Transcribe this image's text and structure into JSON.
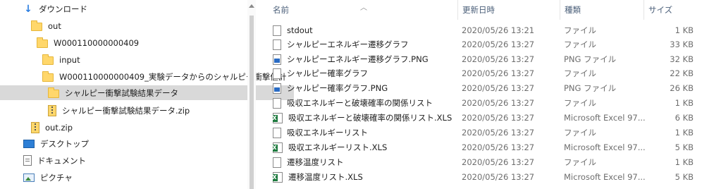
{
  "nav": {
    "items": [
      {
        "label": "ダウンロード",
        "icon": "download-arrow-icon"
      },
      {
        "label": "out",
        "icon": "folder-icon"
      },
      {
        "label": "W000110000000409",
        "icon": "folder-icon"
      },
      {
        "label": "input",
        "icon": "folder-icon"
      },
      {
        "label": "W000110000000409_実験データからのシャルピー衝撃値計",
        "icon": "folder-icon"
      },
      {
        "label": "シャルピー衝撃試験結果データ",
        "icon": "folder-icon"
      },
      {
        "label": "シャルピー衝撃試験結果データ.zip",
        "icon": "zip-icon"
      },
      {
        "label": "out.zip",
        "icon": "zip-icon"
      },
      {
        "label": "デスクトップ",
        "icon": "desktop-icon"
      },
      {
        "label": "ドキュメント",
        "icon": "documents-icon"
      },
      {
        "label": "ピクチャ",
        "icon": "pictures-icon"
      }
    ],
    "selected_index": 5
  },
  "columns": {
    "name": "名前",
    "date": "更新日時",
    "type": "種類",
    "size": "サイズ"
  },
  "files": [
    {
      "name": "stdout",
      "date": "2020/05/26 13:21",
      "type": "ファイル",
      "size": "1 KB",
      "icon": "file-icon"
    },
    {
      "name": "シャルピーエネルギー遷移グラフ",
      "date": "2020/05/26 13:27",
      "type": "ファイル",
      "size": "33 KB",
      "icon": "file-icon"
    },
    {
      "name": "シャルピーエネルギー遷移グラフ.PNG",
      "date": "2020/05/26 13:27",
      "type": "PNG ファイル",
      "size": "32 KB",
      "icon": "png-icon"
    },
    {
      "name": "シャルピー確率グラフ",
      "date": "2020/05/26 13:27",
      "type": "ファイル",
      "size": "22 KB",
      "icon": "file-icon"
    },
    {
      "name": "シャルピー確率グラフ.PNG",
      "date": "2020/05/26 13:27",
      "type": "PNG ファイル",
      "size": "26 KB",
      "icon": "png-icon"
    },
    {
      "name": "吸収エネルギーと破壊確率の関係リスト",
      "date": "2020/05/26 13:27",
      "type": "ファイル",
      "size": "1 KB",
      "icon": "file-icon"
    },
    {
      "name": "吸収エネルギーと破壊確率の関係リスト.XLS",
      "date": "2020/05/26 13:27",
      "type": "Microsoft Excel 97...",
      "size": "6 KB",
      "icon": "excel-icon"
    },
    {
      "name": "吸収エネルギーリスト",
      "date": "2020/05/26 13:27",
      "type": "ファイル",
      "size": "1 KB",
      "icon": "file-icon"
    },
    {
      "name": "吸収エネルギーリスト.XLS",
      "date": "2020/05/26 13:27",
      "type": "Microsoft Excel 97...",
      "size": "5 KB",
      "icon": "excel-icon"
    },
    {
      "name": "遷移温度リスト",
      "date": "2020/05/26 13:27",
      "type": "ファイル",
      "size": "1 KB",
      "icon": "file-icon"
    },
    {
      "name": "遷移温度リスト.XLS",
      "date": "2020/05/26 13:27",
      "type": "Microsoft Excel 97...",
      "size": "5 KB",
      "icon": "excel-icon"
    }
  ]
}
